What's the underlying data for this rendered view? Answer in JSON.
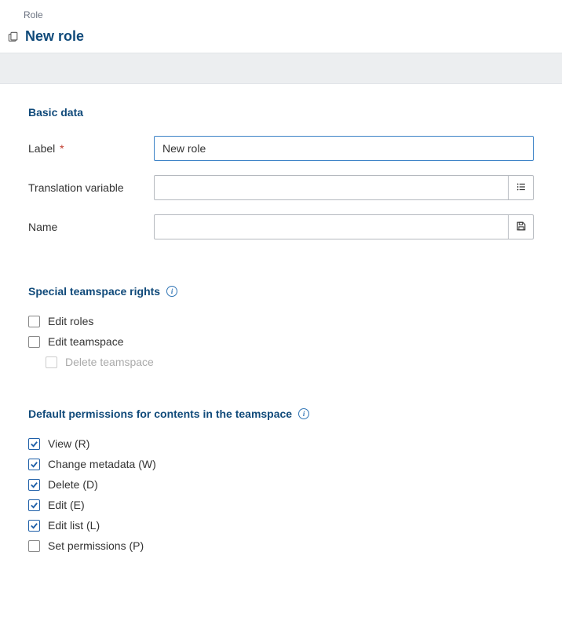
{
  "breadcrumb": "Role",
  "page_title": "New role",
  "sections": {
    "basic_data": {
      "title": "Basic data",
      "fields": {
        "label": {
          "label": "Label",
          "required": "*",
          "value": "New role"
        },
        "translation_variable": {
          "label": "Translation variable",
          "value": ""
        },
        "name": {
          "label": "Name",
          "value": ""
        }
      }
    },
    "special_rights": {
      "title": "Special teamspace rights",
      "items": [
        {
          "label": "Edit roles",
          "checked": false,
          "disabled": false
        },
        {
          "label": "Edit teamspace",
          "checked": false,
          "disabled": false
        },
        {
          "label": "Delete teamspace",
          "checked": false,
          "disabled": true,
          "indent": true
        }
      ]
    },
    "default_permissions": {
      "title": "Default permissions for contents in the teamspace",
      "items": [
        {
          "label": "View (R)",
          "checked": true
        },
        {
          "label": "Change metadata (W)",
          "checked": true
        },
        {
          "label": "Delete (D)",
          "checked": true
        },
        {
          "label": "Edit (E)",
          "checked": true
        },
        {
          "label": "Edit list (L)",
          "checked": true
        },
        {
          "label": "Set permissions (P)",
          "checked": false
        }
      ]
    }
  }
}
